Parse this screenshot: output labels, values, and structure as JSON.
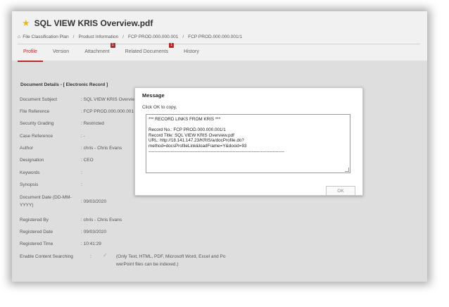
{
  "doc": {
    "title": "SQL VIEW KRIS Overview.pdf",
    "star_icon": "star-icon"
  },
  "breadcrumb": {
    "items": [
      "File Classification Plan",
      "Product Information",
      "FCP PROD.000.000.001",
      "FCP PROD.000.000.001/1"
    ],
    "separator": "/"
  },
  "tabs": [
    {
      "label": "Profile",
      "active": true,
      "badge": ""
    },
    {
      "label": "Version",
      "active": false,
      "badge": ""
    },
    {
      "label": "Attachment",
      "active": false,
      "badge": "1"
    },
    {
      "label": "Related Documents",
      "active": false,
      "badge": "1"
    },
    {
      "label": "History",
      "active": false,
      "badge": ""
    }
  ],
  "details": {
    "section_title": "Document Details - [ Electronic Record ]",
    "rows": [
      {
        "label": "Document Subject",
        "value": ": SQL VIEW KRIS Overvie"
      },
      {
        "label": "File Reference",
        "value": ": FCP PROD.000.000.001"
      },
      {
        "label": "Security Grading",
        "value": ": Restricted"
      },
      {
        "label": "Case Reference",
        "value": ": -"
      },
      {
        "label": "Author",
        "value": ": chris - Chris Evans"
      },
      {
        "label": "Designation",
        "value": ": CEO"
      },
      {
        "label": "Keywords",
        "value": ":"
      },
      {
        "label": "Synopsis",
        "value": ":"
      },
      {
        "label": "Document Date (DD-MM-YYYY)",
        "value": ": 09/03/2020"
      },
      {
        "label": "Registered By",
        "value": ": chris - Chris Evans"
      },
      {
        "label": "Registered Date",
        "value": ": 09/03/2020"
      },
      {
        "label": "Registered Time",
        "value": ": 10:41:29"
      },
      {
        "label": "Enable Content Searching",
        "value": ":"
      }
    ],
    "content_search_note_1": "(Only Text, HTML, PDF, Microsoft Word, Excel and Po",
    "content_search_note_2": "werPoint files can be indexed.)"
  },
  "dialog": {
    "title": "Message",
    "message": "Click OK to copy.",
    "lines": [
      "*** RECORD LINKS FROM KRIS ***",
      "",
      "Record No.: FCP PROD.000.000.001/1",
      "Record Title: SQL VIEW KRIS Overview.pdf",
      "URL: http://18.141.147.23/KRIS/a/docProfile.do?",
      "method=docsProfileLink&loadFrame=Y&docid=93",
      "--------------------------------------------------------------------------------------------"
    ],
    "ok_label": "OK"
  },
  "colors": {
    "accent": "#b52a2a",
    "star": "#e8b923",
    "panel_bg": "#dedede",
    "header_bg": "#f1f1f1"
  }
}
